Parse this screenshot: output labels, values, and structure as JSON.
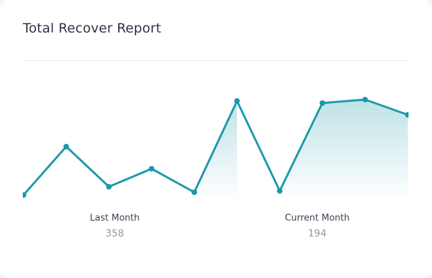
{
  "card": {
    "title": "Total Recover Report"
  },
  "colors": {
    "line": "#1a99a8",
    "fill": "#1a99a8",
    "title": "#2b3445",
    "label": "#3a4252",
    "value": "#8f97a5"
  },
  "stats": {
    "last_month": {
      "label": "Last Month",
      "value": "358"
    },
    "current_month": {
      "label": "Current Month",
      "value": "194"
    }
  },
  "chart_data": {
    "type": "area",
    "values": [
      2,
      72,
      14,
      40,
      6,
      138,
      8,
      135,
      140,
      118
    ],
    "ylim": [
      0,
      145
    ],
    "grid": false,
    "filled_segments": [
      [
        4,
        5
      ],
      [
        6,
        9
      ]
    ]
  }
}
